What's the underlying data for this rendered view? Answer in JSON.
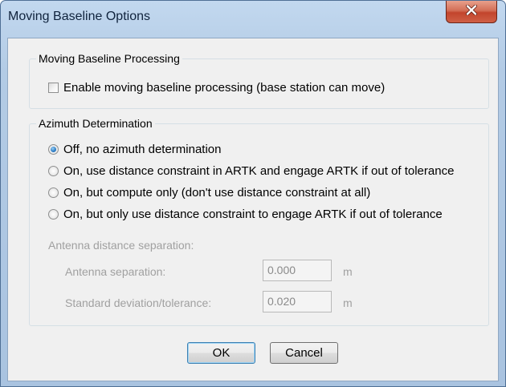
{
  "window": {
    "title": "Moving Baseline Options"
  },
  "moving_baseline": {
    "group_label": "Moving Baseline Processing",
    "enable_checkbox": {
      "label": "Enable moving baseline processing (base station can move)",
      "checked": false
    }
  },
  "azimuth": {
    "group_label": "Azimuth Determination",
    "options": [
      {
        "label": "Off, no azimuth determination",
        "selected": true
      },
      {
        "label": "On, use distance constraint in ARTK and engage ARTK if out of tolerance",
        "selected": false
      },
      {
        "label": "On, but compute only (don't use distance constraint at all)",
        "selected": false
      },
      {
        "label": "On, but only use distance constraint to engage ARTK if out of tolerance",
        "selected": false
      }
    ],
    "separation_heading": "Antenna distance separation:",
    "antenna_separation": {
      "label": "Antenna separation:",
      "value": "0.000",
      "unit": "m",
      "enabled": false
    },
    "std_deviation": {
      "label": "Standard deviation/tolerance:",
      "value": "0.020",
      "unit": "m",
      "enabled": false
    }
  },
  "buttons": {
    "ok": "OK",
    "cancel": "Cancel"
  }
}
